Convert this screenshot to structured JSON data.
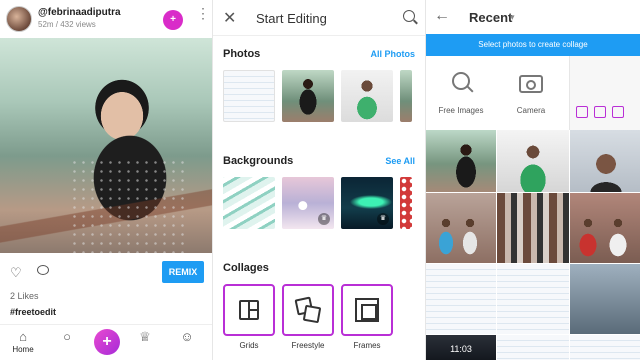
{
  "panel1": {
    "username": "@febrinaadiputra",
    "upload_info": "52m / 432 views",
    "remix_label": "REMIX",
    "likes": "2 Likes",
    "hashtag": "#freetoedit",
    "nav": {
      "home_label": "Home",
      "add_label": "+"
    },
    "icons": [
      "add-friend-icon",
      "more-vert-icon",
      "heart-icon",
      "comment-icon",
      "home-icon",
      "search-icon",
      "trophy-icon",
      "profile-icon"
    ]
  },
  "panel2": {
    "title": "Start Editing",
    "photos_title": "Photos",
    "photos_link": "All Photos",
    "backgrounds_title": "Backgrounds",
    "backgrounds_link": "See All",
    "collages_title": "Collages",
    "collage_options": [
      {
        "label": "Grids"
      },
      {
        "label": "Freestyle"
      },
      {
        "label": "Frames"
      }
    ]
  },
  "panel3": {
    "title": "Recent",
    "banner": "Select photos to create collage",
    "sources": [
      {
        "label": "Free Images",
        "icon": "search-icon"
      },
      {
        "label": "Camera",
        "icon": "camera-icon"
      }
    ],
    "lock_time": "11:03"
  },
  "colors": {
    "accent_blue": "#1e9cf3",
    "accent_magenta": "#b92fd6",
    "add_button": "#d92cc9"
  }
}
